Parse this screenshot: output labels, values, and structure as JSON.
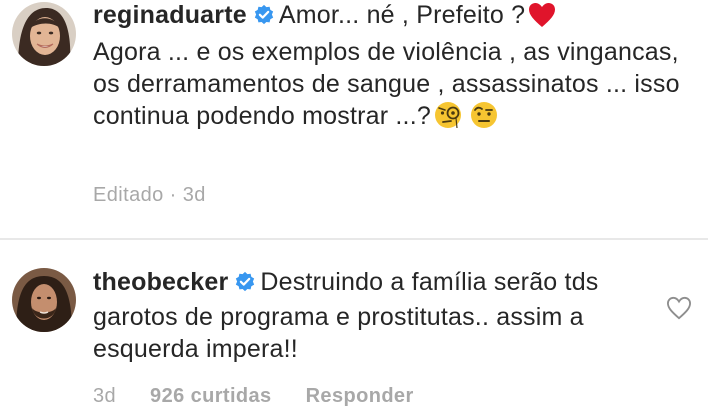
{
  "comments": [
    {
      "username": "reginaduarte",
      "verified": true,
      "text_prefix": "Amor... né , Prefeito ?",
      "text_main": "Agora ... e os exemplos de  violência , as vingancas,  os derramamentos de sangue , assassinatos ... isso continua podendo mostrar ...?",
      "edited_label": "Editado",
      "separator": "·",
      "time": "3d",
      "emojis": [
        "red-heart-emoji",
        "face-with-monocle-emoji",
        "face-with-raised-eyebrow-emoji"
      ]
    },
    {
      "username": "theobecker",
      "verified": true,
      "text": "Destruindo a família serão tds garotos de programa e prostitutas.. assim a esquerda impera!!",
      "time": "3d",
      "likes": "926 curtidas",
      "reply_label": "Responder",
      "icons": [
        "like-heart-outline-icon"
      ]
    }
  ],
  "colors": {
    "text": "#262626",
    "meta": "#a8a8a8",
    "verified_badge": "#3897f0",
    "heart_emoji": "#e0142b",
    "divider": "#e8e8e8"
  }
}
